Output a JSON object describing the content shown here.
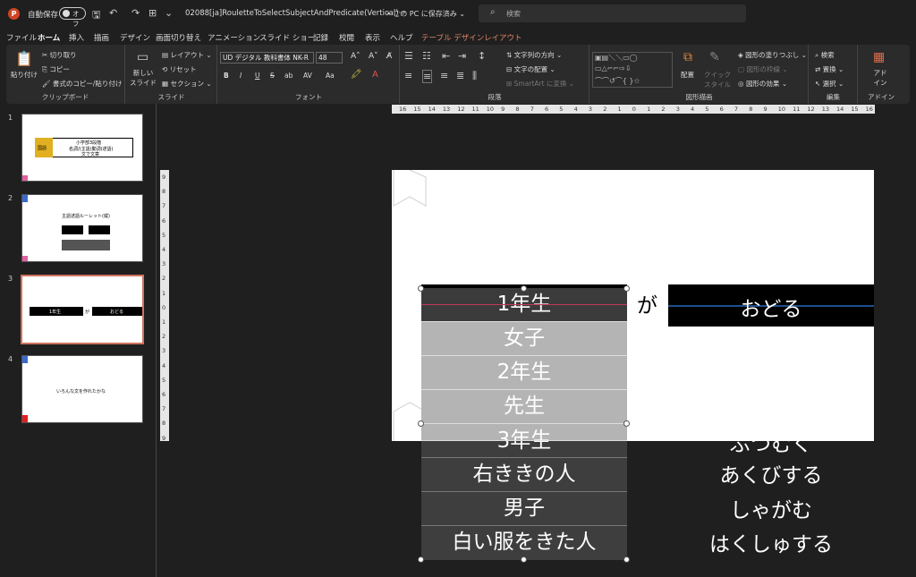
{
  "titlebar": {
    "app_icon": "P",
    "autosave_label": "自動保存",
    "autosave_state": "オフ",
    "doc_title": "02088[ja]RouletteToSelectSubjectAndPredicate(Vertical)···",
    "save_state": "• この PC に保存済み ⌄",
    "search_placeholder": "検索"
  },
  "menu": {
    "tabs": [
      "ファイル",
      "ホーム",
      "挿入",
      "描画",
      "デザイン",
      "画面切り替え",
      "アニメーション",
      "スライド ショー",
      "記録",
      "校閲",
      "表示",
      "ヘルプ",
      "テーブル デザイン",
      "レイアウト"
    ]
  },
  "ribbon": {
    "clipboard": {
      "paste": "貼り付け",
      "cut": "切り取り",
      "copy": "コピー",
      "format_painter": "書式のコピー/貼り付け",
      "label": "クリップボード"
    },
    "slides": {
      "new_slide": "新しい スライド",
      "layout": "レイアウト",
      "reset": "リセット",
      "section": "セクション",
      "label": "スライド"
    },
    "font": {
      "font_name": "UD デジタル 教科書体 NK-R",
      "font_size": "48",
      "label": "フォント",
      "buttons": [
        "B",
        "I",
        "U",
        "S",
        "ab",
        "AV",
        "Aa"
      ]
    },
    "paragraph": {
      "text_direction": "文字列の方向",
      "align_text": "文字の配置",
      "smartart": "SmartArt に変換",
      "label": "段落"
    },
    "drawing": {
      "arrange": "配置",
      "quick_styles": "クイック スタイル",
      "shape_fill": "図形の塗りつぶし",
      "shape_outline": "図形の枠線",
      "shape_effects": "図形の効果",
      "label": "図形描画"
    },
    "editing": {
      "find": "検索",
      "replace": "置換",
      "select": "選択",
      "label": "編集"
    },
    "addins": {
      "addin": "アド イン",
      "label": "アドイン"
    }
  },
  "thumbnails": [
    {
      "num": "1",
      "t1": "小学部3段階",
      "t2": "名詞/(主語)動詞(述語)",
      "t3": "文で文章",
      "box": "国語"
    },
    {
      "num": "2",
      "t1": "主語述語ルーレット(縦)"
    },
    {
      "num": "3",
      "t1": "1年生",
      "t2": "が",
      "t3": "おどる"
    },
    {
      "num": "4",
      "t1": "いろんな文を作れたかな"
    }
  ],
  "slide": {
    "subject_items": [
      "1年生",
      "女子",
      "2年生",
      "先生",
      "3年生",
      "右ききの人",
      "男子",
      "白い服をきた人"
    ],
    "particle": "が",
    "predicate_selected": "おどる",
    "predicate_partial": "ぶつむく",
    "predicate_items": [
      "あくびする",
      "しゃがむ",
      "はくしゅする"
    ]
  },
  "ruler": {
    "h": [
      "16",
      "15",
      "14",
      "13",
      "12",
      "11",
      "10",
      "9",
      "8",
      "7",
      "6",
      "5",
      "4",
      "3",
      "2",
      "1",
      "0",
      "1",
      "2",
      "3",
      "4",
      "5",
      "6",
      "7",
      "8",
      "9",
      "10",
      "11",
      "12",
      "13",
      "14",
      "15",
      "16"
    ],
    "v": [
      "9",
      "8",
      "7",
      "6",
      "5",
      "4",
      "3",
      "2",
      "1",
      "0",
      "1",
      "2",
      "3",
      "4",
      "5",
      "6",
      "7",
      "8",
      "9"
    ]
  }
}
